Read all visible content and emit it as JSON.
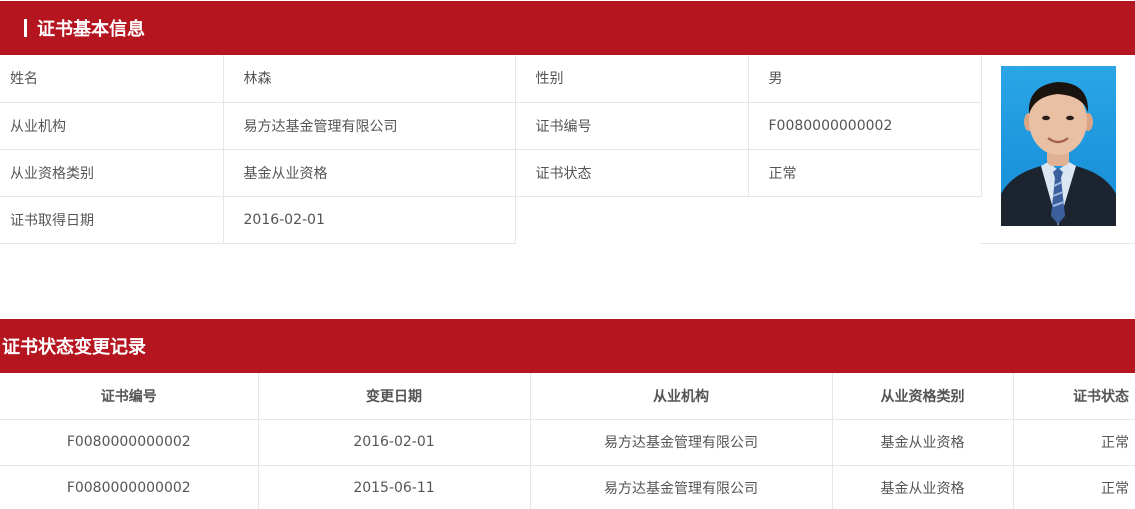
{
  "basic_info": {
    "title": "证书基本信息",
    "rows": [
      [
        {
          "label": "姓名",
          "value": "林森"
        },
        {
          "label": "性别",
          "value": "男"
        }
      ],
      [
        {
          "label": "从业机构",
          "value": "易方达基金管理有限公司"
        },
        {
          "label": "证书编号",
          "value": "F0080000000002"
        }
      ],
      [
        {
          "label": "从业资格类别",
          "value": "基金从业资格"
        },
        {
          "label": "证书状态",
          "value": "正常"
        }
      ],
      [
        {
          "label": "证书取得日期",
          "value": "2016-02-01"
        }
      ]
    ]
  },
  "records": {
    "title": "证书状态变更记录",
    "headers": [
      "证书编号",
      "变更日期",
      "从业机构",
      "从业资格类别",
      "证书状态"
    ],
    "rows": [
      [
        "F0080000000002",
        "2016-02-01",
        "易方达基金管理有限公司",
        "基金从业资格",
        "正常"
      ],
      [
        "F0080000000002",
        "2015-06-11",
        "易方达基金管理有限公司",
        "基金从业资格",
        "正常"
      ]
    ]
  },
  "colors": {
    "header_bg": "#b5151f",
    "border": "#e6e6e6",
    "photo_bg": "#1d95dd"
  }
}
